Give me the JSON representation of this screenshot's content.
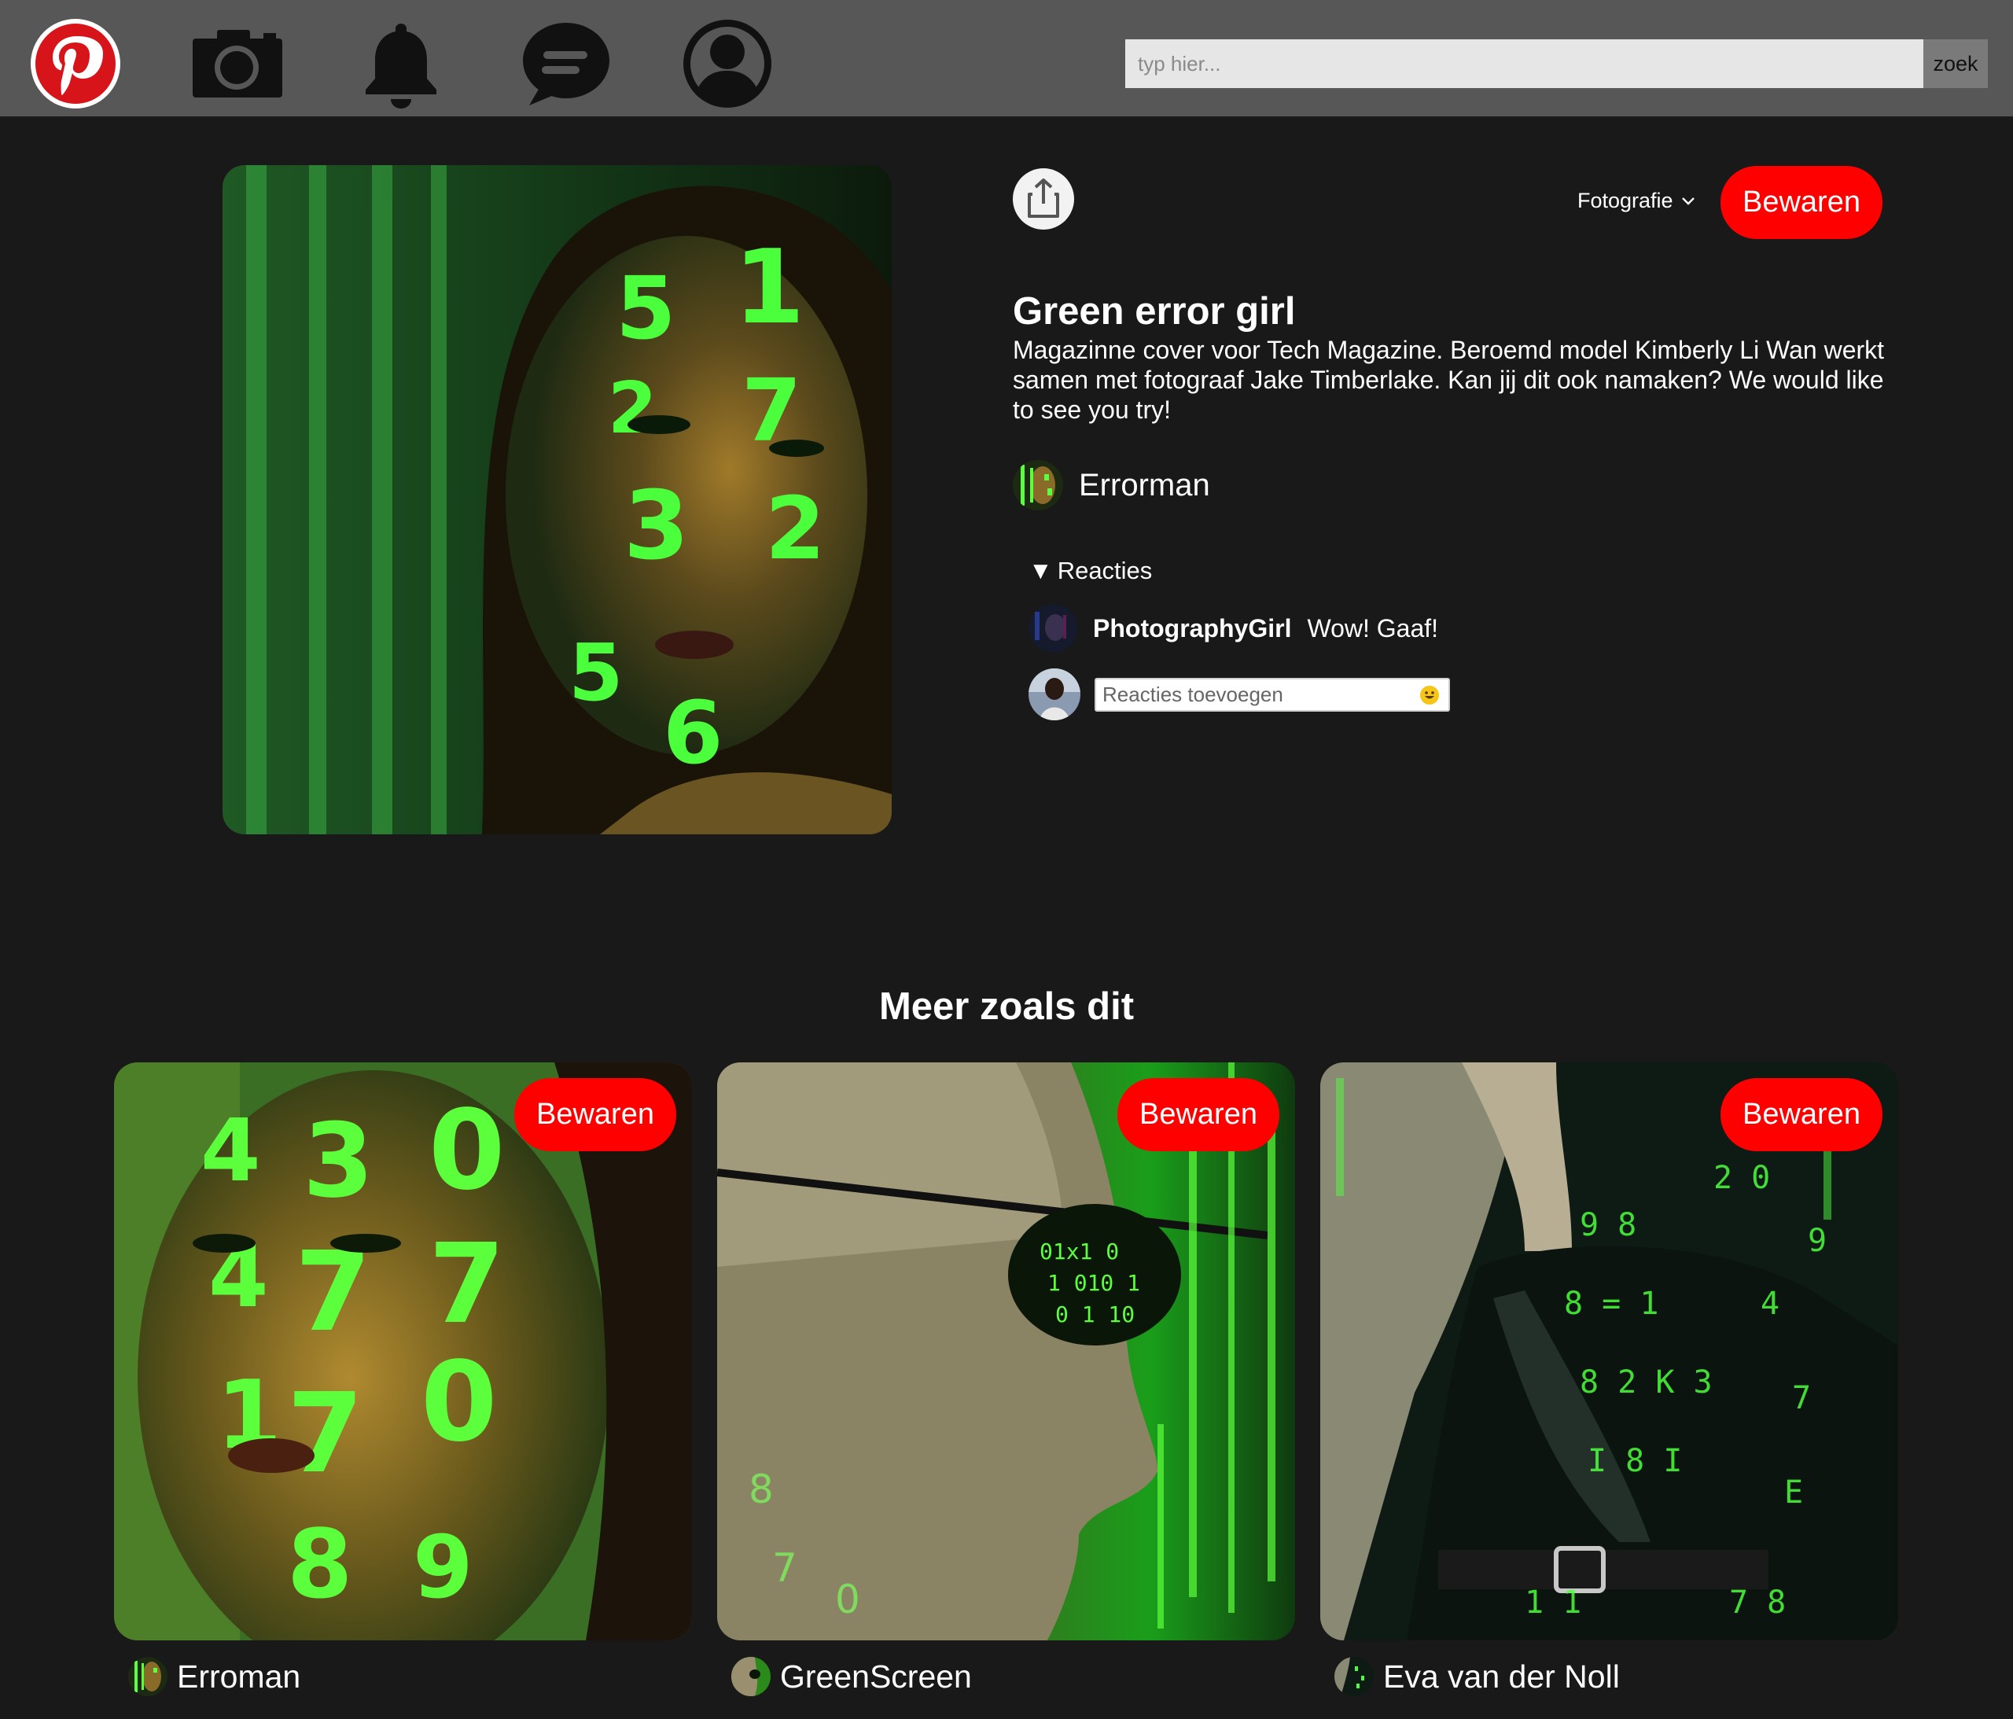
{
  "colors": {
    "topbar": "#575757",
    "background": "#191919",
    "brand_red": "#ff0000",
    "text": "#ffffff"
  },
  "nav": {
    "icons": [
      "pinterest-logo-icon",
      "camera-icon",
      "bell-icon",
      "chat-icon",
      "profile-icon"
    ]
  },
  "search": {
    "placeholder": "typ hier...",
    "button_label": "zoek"
  },
  "pin": {
    "share_icon": "share-icon",
    "category": "Fotografie",
    "save_label": "Bewaren",
    "title": "Green error girl",
    "description": "Magazinne cover voor Tech Magazine. Beroemd model Kimberly Li Wan werkt samen met fotograaf Jake Timberlake. Kan jij dit ook namaken? We would like to see you try!",
    "author": "Errorman",
    "comments": {
      "toggle_label": "Reacties",
      "items": [
        {
          "user": "PhotographyGirl",
          "text": "Wow! Gaaf!"
        }
      ],
      "input_placeholder": "Reacties toevoegen"
    }
  },
  "more": {
    "title": "Meer zoals dit",
    "cards": [
      {
        "save_label": "Bewaren",
        "author": "Erroman"
      },
      {
        "save_label": "Bewaren",
        "author": "GreenScreen"
      },
      {
        "save_label": "Bewaren",
        "author": "Eva van der Noll"
      }
    ]
  }
}
